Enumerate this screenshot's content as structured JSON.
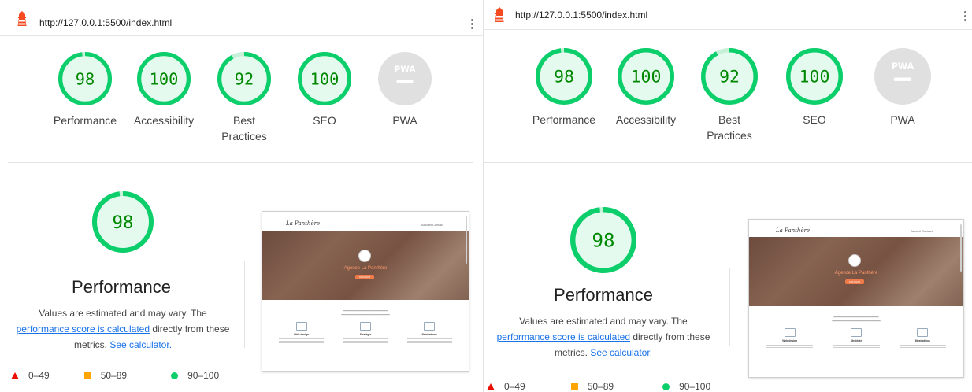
{
  "panels": [
    {
      "url": "http://127.0.0.1:5500/index.html",
      "gauges": [
        {
          "score": "98",
          "label": "Performance",
          "value": 98
        },
        {
          "score": "100",
          "label": "Accessibility",
          "value": 100
        },
        {
          "score": "92",
          "label": "Best Practices",
          "value": 92
        },
        {
          "score": "100",
          "label": "SEO",
          "value": 100
        },
        {
          "score": "",
          "label": "PWA",
          "value": 0
        }
      ],
      "perf": {
        "score": "98",
        "value": 98,
        "title": "Performance",
        "desc_pre": "Values are estimated and may vary. The",
        "link_calc": "performance score is calculated",
        "desc_mid": "directly from these metrics.",
        "link_see": "See calculator."
      },
      "legend": {
        "red": "0–49",
        "orange": "50–89",
        "green": "90–100"
      }
    },
    {
      "url": "http://127.0.0.1:5500/index.html",
      "gauges": [
        {
          "score": "98",
          "label": "Performance",
          "value": 98
        },
        {
          "score": "100",
          "label": "Accessibility",
          "value": 100
        },
        {
          "score": "92",
          "label": "Best Practices",
          "value": 92
        },
        {
          "score": "100",
          "label": "SEO",
          "value": 100
        },
        {
          "score": "",
          "label": "PWA",
          "value": 0
        }
      ],
      "perf": {
        "score": "98",
        "value": 98,
        "title": "Performance",
        "desc_pre": "Values are estimated and may vary. The",
        "link_calc": "performance score is calculated",
        "desc_mid": "directly from these metrics.",
        "link_see": "See calculator."
      },
      "legend": {
        "red": "0–49",
        "orange": "50–89",
        "green": "90–100"
      }
    }
  ],
  "pwa_badge": "PWA",
  "colors": {
    "pass": "#0cce6b",
    "pass_text": "#008800",
    "pass_fill": "#e5faef",
    "na": "#e0e0e0",
    "fail": "#eb0f00",
    "average": "#ffa400",
    "link": "#1a73e8"
  },
  "thumbnail": {
    "brand": "La Panthère",
    "hero_title": "Agence La Panthère",
    "hero_button": "CONTACT",
    "nav": "Accueil   Contact",
    "col_titles": [
      "Web design",
      "Stratégie",
      "Illustrations"
    ]
  }
}
